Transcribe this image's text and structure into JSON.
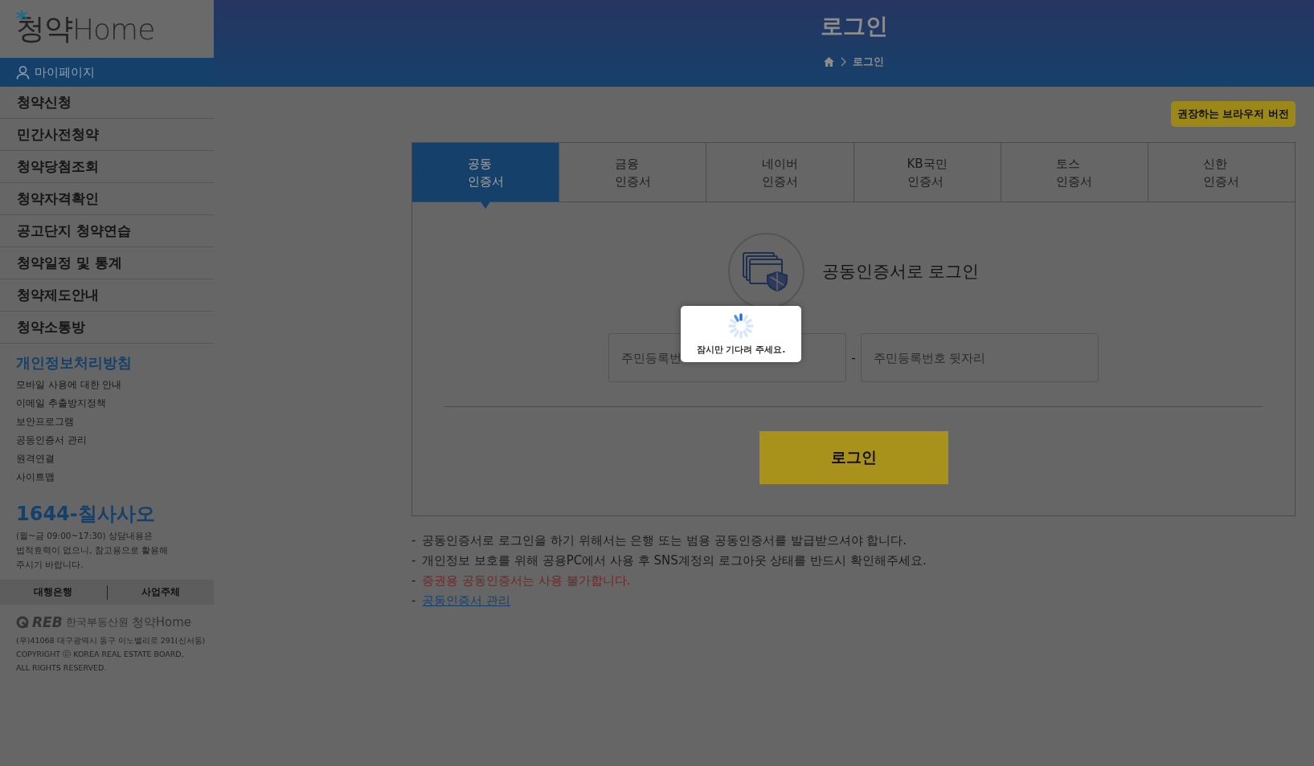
{
  "sidebar": {
    "logo": {
      "prefix": "청약",
      "suffix": "Home"
    },
    "mypage": "마이페이지",
    "menu": [
      "청약신청",
      "민간사전청약",
      "청약당첨조회",
      "청약자격확인",
      "공고단지 청약연습",
      "청약일정 및 통계",
      "청약제도안내",
      "청약소통방"
    ],
    "policy_title": "개인정보처리방침",
    "links": [
      "모바일 사용에 대한 안내",
      "이메일 추출방지정책",
      "보안프로그램",
      "공동인증서 관리",
      "원격연결",
      "사이트맵"
    ],
    "phone": "1644-칠사사오",
    "phone_note": [
      "(월~금 09:00~17:30) 상담내용은",
      "법적효력이 없으니, 참고용으로 활용해",
      "주시기 바랍니다."
    ],
    "footer_tabs": [
      "대행은행",
      "사업주체"
    ],
    "org": {
      "logo": "REB",
      "name": "한국부동산원",
      "brand_prefix": "청약",
      "brand_suffix": "Home"
    },
    "address": "(우)41068 대구광역시 동구 이노밸리로 291(신서동)",
    "copyright": [
      "COPYRIGHT ⓒ KOREA REAL ESTATE BOARD,",
      "ALL RIGHTS RESERVED."
    ]
  },
  "header": {
    "title": "로그인",
    "breadcrumb": "로그인"
  },
  "browser_badge": "권장하는 브라우저 버전",
  "tabs": [
    {
      "lines": [
        "공동",
        "인증서"
      ],
      "selected": true
    },
    {
      "lines": [
        "금융",
        "인증서"
      ],
      "selected": false
    },
    {
      "lines": [
        "네이버",
        "인증서"
      ],
      "selected": false
    },
    {
      "lines": [
        "KB국민",
        "인증서"
      ],
      "selected": false
    },
    {
      "lines": [
        "토스",
        "인증서"
      ],
      "selected": false
    },
    {
      "lines": [
        "신한",
        "인증서"
      ],
      "selected": false
    }
  ],
  "panel": {
    "heading": "공동인증서로 로그인",
    "front_placeholder": "주민등록번",
    "separator": "-",
    "back_placeholder": "주민등록번호 뒷자리",
    "button": "로그인"
  },
  "notes": [
    {
      "kind": "plain",
      "text": "공동인증서로 로그인을 하기 위해서는 은행 또는 범용 공동인증서를 발급받으셔야 합니다."
    },
    {
      "kind": "plain",
      "text": "개인정보 보호를 위해 공용PC에서 사용 후 SNS계정의 로그아웃 상태를 반드시 확인해주세요."
    },
    {
      "kind": "warning",
      "text": "증권용 공동인증서는 사용 불가합니다."
    },
    {
      "kind": "link",
      "text": "공동인증서 관리"
    }
  ],
  "note_bullet": "-",
  "loading": {
    "message": "잠시만 기다려 주세요."
  }
}
